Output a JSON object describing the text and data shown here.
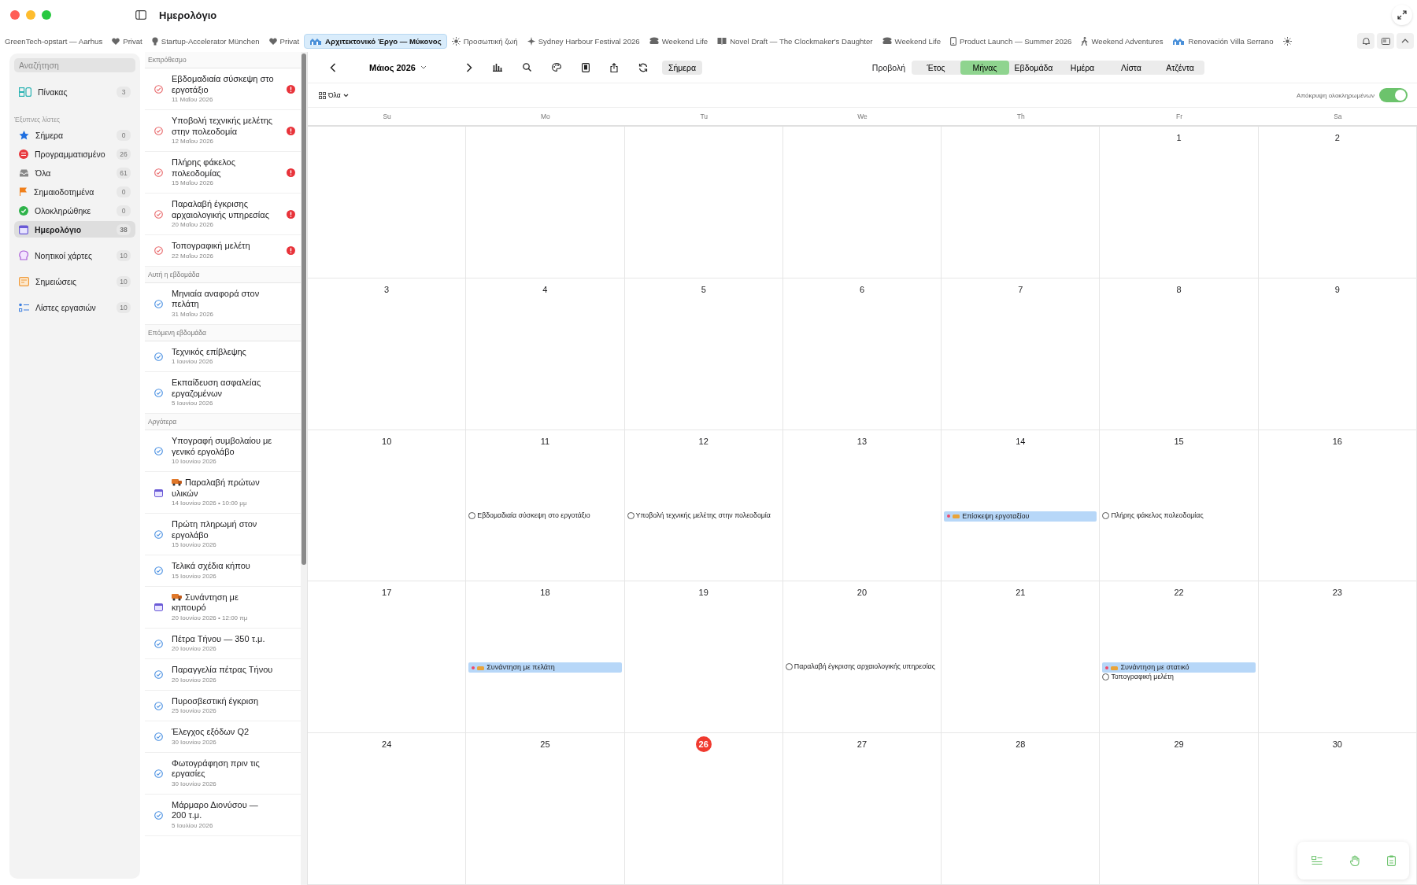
{
  "window": {
    "title": "Ημερολόγιο"
  },
  "tabs": [
    {
      "label": "GreenTech-opstart — Aarhus",
      "kind": "none",
      "selected": false
    },
    {
      "label": "Privat",
      "kind": "heart",
      "selected": false
    },
    {
      "label": "Startup-Accelerator München",
      "kind": "bulb",
      "selected": false
    },
    {
      "label": "Privat",
      "kind": "heart",
      "selected": false
    },
    {
      "label": "Αρχιτεκτονικό Έργο — Μύκονος",
      "kind": "building",
      "selected": true
    },
    {
      "label": "Προσωπική ζωή",
      "kind": "sun",
      "selected": false
    },
    {
      "label": "Sydney Harbour Festival 2026",
      "kind": "sparkle",
      "selected": false
    },
    {
      "label": "Weekend Life",
      "kind": "stack",
      "selected": false
    },
    {
      "label": "Novel Draft — The Clockmaker's Daughter",
      "kind": "book",
      "selected": false
    },
    {
      "label": "Weekend Life",
      "kind": "stack",
      "selected": false
    },
    {
      "label": "Product Launch — Summer 2026",
      "kind": "phone",
      "selected": false
    },
    {
      "label": "Weekend Adventures",
      "kind": "walker",
      "selected": false
    },
    {
      "label": "Renovación Villa Serrano",
      "kind": "building",
      "selected": false
    },
    {
      "kind": "sun",
      "selected": false
    }
  ],
  "sidebar": {
    "search": {
      "placeholder": "Αναζήτηση"
    },
    "groups": [
      {
        "items": [
          {
            "label": "Πίνακας",
            "count": "3",
            "kind": "board",
            "selected": false
          }
        ]
      },
      {
        "label": "Έξυπνες λίστες",
        "items": [
          {
            "label": "Σήμερα",
            "count": "0",
            "kind": "star",
            "selected": false
          },
          {
            "label": "Προγραμματισμένο",
            "count": "26",
            "kind": "scheduled",
            "selected": false
          },
          {
            "label": "Όλα",
            "count": "61",
            "kind": "inbox",
            "selected": false
          },
          {
            "label": "Σημαιοδοτημένα",
            "count": "0",
            "kind": "flag",
            "selected": false
          },
          {
            "label": "Ολοκληρώθηκε",
            "count": "0",
            "kind": "done",
            "selected": false
          },
          {
            "label": "Ημερολόγιο",
            "count": "38",
            "kind": "calendar",
            "selected": true
          }
        ]
      },
      {
        "items": [
          {
            "label": "Νοητικοί χάρτες",
            "count": "10",
            "kind": "mindmap",
            "selected": false
          }
        ]
      },
      {
        "items": [
          {
            "label": "Σημειώσεις",
            "count": "10",
            "kind": "notes",
            "selected": false
          }
        ]
      },
      {
        "items": [
          {
            "label": "Λίστες εργασιών",
            "count": "10",
            "kind": "checklist",
            "selected": false
          }
        ]
      }
    ]
  },
  "task_list": {
    "sections": [
      {
        "title": "Εκπρόθεσμο",
        "items": [
          {
            "title": "Εβδομαδιαία σύσκεψη στο εργοτάξιο",
            "date": "11 Μαΐου 2026",
            "kind": "overdue",
            "flagged": true
          },
          {
            "title": "Υποβολή τεχνικής μελέτης στην πολεοδομία",
            "date": "12 Μαΐου 2026",
            "kind": "overdue",
            "flagged": true
          },
          {
            "title": "Πλήρης φάκελος πολεοδομίας",
            "date": "15 Μαΐου 2026",
            "kind": "overdue",
            "flagged": true
          },
          {
            "title": "Παραλαβή έγκρισης αρχαιολογικής υπηρεσίας",
            "date": "20 Μαΐου 2026",
            "kind": "overdue",
            "flagged": true
          },
          {
            "title": "Τοπογραφική μελέτη",
            "date": "22 Μαΐου 2026",
            "kind": "overdue",
            "flagged": true
          }
        ]
      },
      {
        "title": "Αυτή η εβδομάδα",
        "items": [
          {
            "title": "Μηνιαία αναφορά στον πελάτη",
            "date": "31 Μαΐου 2026",
            "kind": "task",
            "flagged": false
          }
        ]
      },
      {
        "title": "Επόμενη εβδομάδα",
        "items": [
          {
            "title": "Τεχνικός επίβλεψης",
            "date": "1 Ιουνίου 2026",
            "kind": "task",
            "flagged": false
          },
          {
            "title": "Εκπαίδευση ασφαλείας εργαζομένων",
            "date": "5 Ιουνίου 2026",
            "kind": "task",
            "flagged": false
          }
        ]
      },
      {
        "title": "Αργότερα",
        "items": [
          {
            "title": "Υπογραφή συμβολαίου με γενικό εργολάβο",
            "date": "10 Ιουνίου 2026",
            "kind": "task",
            "flagged": false
          },
          {
            "title": "Παραλαβή πρώτων υλικών",
            "date": "14 Ιουνίου 2026 • 10:00 μμ",
            "kind": "event",
            "flagged": false
          },
          {
            "title": "Πρώτη πληρωμή στον εργολάβο",
            "date": "15 Ιουνίου 2026",
            "kind": "task",
            "flagged": false
          },
          {
            "title": "Τελικά σχέδια κήπου",
            "date": "15 Ιουνίου 2026",
            "kind": "task",
            "flagged": false
          },
          {
            "title": "Συνάντηση με κηπουρό",
            "date": "20 Ιουνίου 2026 • 12:00 πμ",
            "kind": "event",
            "flagged": false
          },
          {
            "title": "Πέτρα Τήνου — 350 τ.μ.",
            "date": "20 Ιουνίου 2026",
            "kind": "task",
            "flagged": false
          },
          {
            "title": "Παραγγελία πέτρας Τήνου",
            "date": "20 Ιουνίου 2026",
            "kind": "task",
            "flagged": false
          },
          {
            "title": "Πυροσβεστική έγκριση",
            "date": "25 Ιουνίου 2026",
            "kind": "task",
            "flagged": false
          },
          {
            "title": "Έλεγχος εξόδων Q2",
            "date": "30 Ιουνίου 2026",
            "kind": "task",
            "flagged": false
          },
          {
            "title": "Φωτογράφηση πριν τις εργασίες",
            "date": "30 Ιουνίου 2026",
            "kind": "task",
            "flagged": false
          },
          {
            "title": "Μάρμαρο Διονύσου — 200 τ.μ.",
            "date": "5 Ιουλίου 2026",
            "kind": "task",
            "flagged": false
          }
        ]
      }
    ]
  },
  "calendar": {
    "month": "Μάιος 2026",
    "today_button": "Σήμερα",
    "view_label": "Προβολή",
    "views": [
      {
        "label": "Έτος",
        "selected": false
      },
      {
        "label": "Μήνας",
        "selected": true
      },
      {
        "label": "Εβδομάδα",
        "selected": false
      },
      {
        "label": "Ημέρα",
        "selected": false
      },
      {
        "label": "Λίστα",
        "selected": false
      },
      {
        "label": "Ατζέντα",
        "selected": false
      }
    ],
    "filter": "Όλα",
    "hide_completed": {
      "label": "Απόκρυψη ολοκληρωμένων",
      "on": true
    },
    "weekdays": [
      "Su",
      "Mo",
      "Tu",
      "We",
      "Th",
      "Fr",
      "Sa"
    ],
    "weeks": [
      [
        {
          "day": "1",
          "today": false
        },
        {
          "day": "2",
          "today": false
        }
      ],
      [
        {
          "day": "3",
          "today": false
        },
        {
          "day": "4",
          "today": false
        },
        {
          "day": "5",
          "today": false
        },
        {
          "day": "6",
          "today": false
        },
        {
          "day": "7",
          "today": false
        },
        {
          "day": "8",
          "today": false
        },
        {
          "day": "9",
          "today": false
        }
      ],
      [
        {
          "day": "10",
          "today": false
        },
        {
          "day": "11",
          "today": false,
          "events": [
            {
              "kind": "task",
              "title": "Εβδομαδιαία σύσκεψη στο εργοτάξιο"
            }
          ]
        },
        {
          "day": "12",
          "today": false,
          "events": [
            {
              "kind": "task",
              "title": "Υποβολή τεχνικής μελέτης στην πολεοδομία"
            }
          ]
        },
        {
          "day": "13",
          "today": false
        },
        {
          "day": "14",
          "today": false,
          "events": [
            {
              "kind": "event",
              "title": "Επίσκεψη εργοταξίου"
            }
          ]
        },
        {
          "day": "15",
          "today": false,
          "events": [
            {
              "kind": "task",
              "title": "Πλήρης φάκελος πολεοδομίας"
            }
          ]
        },
        {
          "day": "16",
          "today": false
        }
      ],
      [
        {
          "day": "17",
          "today": false
        },
        {
          "day": "18",
          "today": false,
          "events": [
            {
              "kind": "event",
              "title": "Συνάντηση με πελάτη"
            }
          ]
        },
        {
          "day": "19",
          "today": false
        },
        {
          "day": "20",
          "today": false,
          "events": [
            {
              "kind": "task",
              "title": "Παραλαβή έγκρισης αρχαιολογικής υπηρεσίας"
            }
          ]
        },
        {
          "day": "21",
          "today": false
        },
        {
          "day": "22",
          "today": false,
          "events": [
            {
              "kind": "event",
              "title": "Συνάντηση με στατικό"
            },
            {
              "kind": "task",
              "title": "Τοπογραφική μελέτη"
            }
          ]
        },
        {
          "day": "23",
          "today": false
        }
      ],
      [
        {
          "day": "24",
          "today": false
        },
        {
          "day": "25",
          "today": false
        },
        {
          "day": "26",
          "today": true
        },
        {
          "day": "27",
          "today": false
        },
        {
          "day": "28",
          "today": false
        },
        {
          "day": "29",
          "today": false
        },
        {
          "day": "30",
          "today": false
        }
      ]
    ]
  }
}
